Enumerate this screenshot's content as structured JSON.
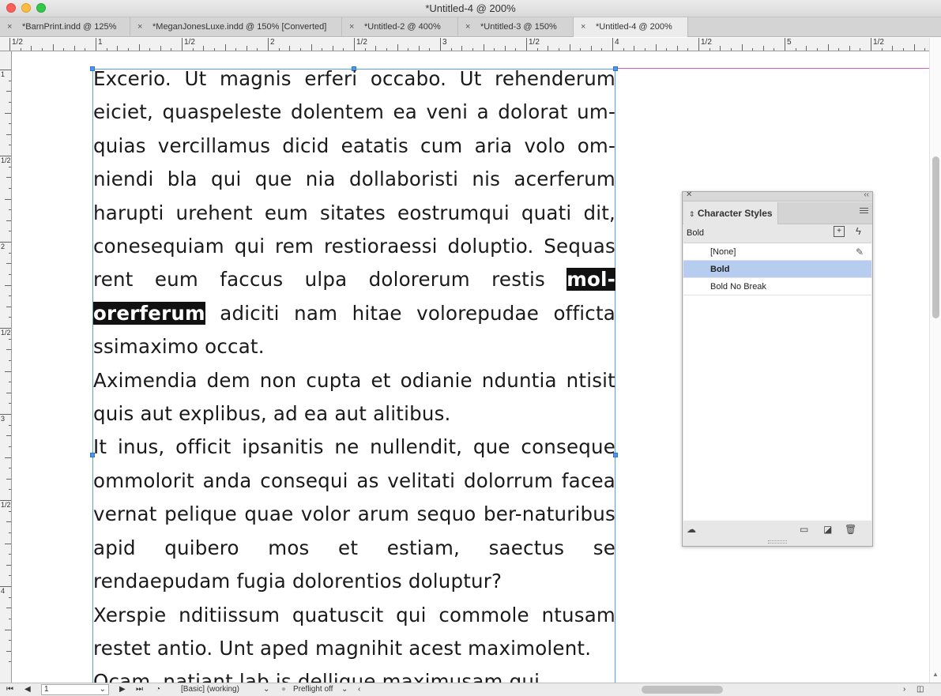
{
  "window": {
    "title": "*Untitled-4 @ 200%"
  },
  "tabs": [
    {
      "label": "*BarnPrint.indd @ 125%",
      "close": "×"
    },
    {
      "label": "*MeganJonesLuxe.indd @ 150% [Converted]",
      "close": "×"
    },
    {
      "label": "*Untitled-2 @ 400%",
      "close": "×"
    },
    {
      "label": "*Untitled-3 @ 150%",
      "close": "×"
    },
    {
      "label": "*Untitled-4 @ 200%",
      "close": "×",
      "active": true
    }
  ],
  "ruler": {
    "h_labels": [
      "1/2",
      "1",
      "1/2",
      "2",
      "1/2",
      "3",
      "1/2",
      "4",
      "1/2",
      "5",
      "1/2"
    ],
    "v_labels": [
      "1",
      "1/2",
      "2",
      "1/2",
      "3",
      "1/2",
      "4"
    ]
  },
  "story": {
    "para1_before": "Excerio. Ut magnis erferi occabo. Ut rehenderum eiciet, quaspeleste dolentem ea veni a dolorat um-quias vercillamus dicid eatatis cum aria volo om-niendi bla qui que nia dollaboristi nis acerferum harupti urehent eum sitates eostrumqui quati dit, conesequiam qui rem restioraessi doluptio. Sequas rent eum faccus ulpa dolorerum restis ",
    "para1_selected": "mol-orerferum",
    "para1_after": " adiciti nam hitae volorepudae officta ssimaximo occat.",
    "para2": "Aximendia dem non cupta et odianie nduntia ntisit quis aut explibus, ad ea aut alitibus.",
    "para3": "It inus, officit ipsanitis ne nullendit, que conseque ommolorit anda consequi as velitati dolorrum facea vernat pelique quae volor arum sequo ber-naturibus apid quibero mos et estiam, saectus se rendaepudam fugia dolorentios doluptur?",
    "para4": "Xerspie nditiissum quatuscit qui commole ntusam restet antio. Unt aped magnihit acest maximolent.",
    "para5": "Ocam, natiant lab is dellique maximusam qui"
  },
  "panel": {
    "title": "Character Styles",
    "current_style": "Bold",
    "styles": [
      {
        "name": "[None]",
        "selected": false
      },
      {
        "name": "Bold",
        "selected": true
      },
      {
        "name": "Bold No Break",
        "selected": false
      }
    ],
    "icons": [
      "close-icon",
      "collapse-icon",
      "panel-menu-icon",
      "new-style-override-icon",
      "quick-apply-icon",
      "edit-lock-icon",
      "cloud-library-icon",
      "folder-icon",
      "new-style-icon",
      "trash-icon"
    ]
  },
  "statusbar": {
    "page": "1",
    "profile": "[Basic] (working)",
    "preflight": "Preflight off"
  }
}
